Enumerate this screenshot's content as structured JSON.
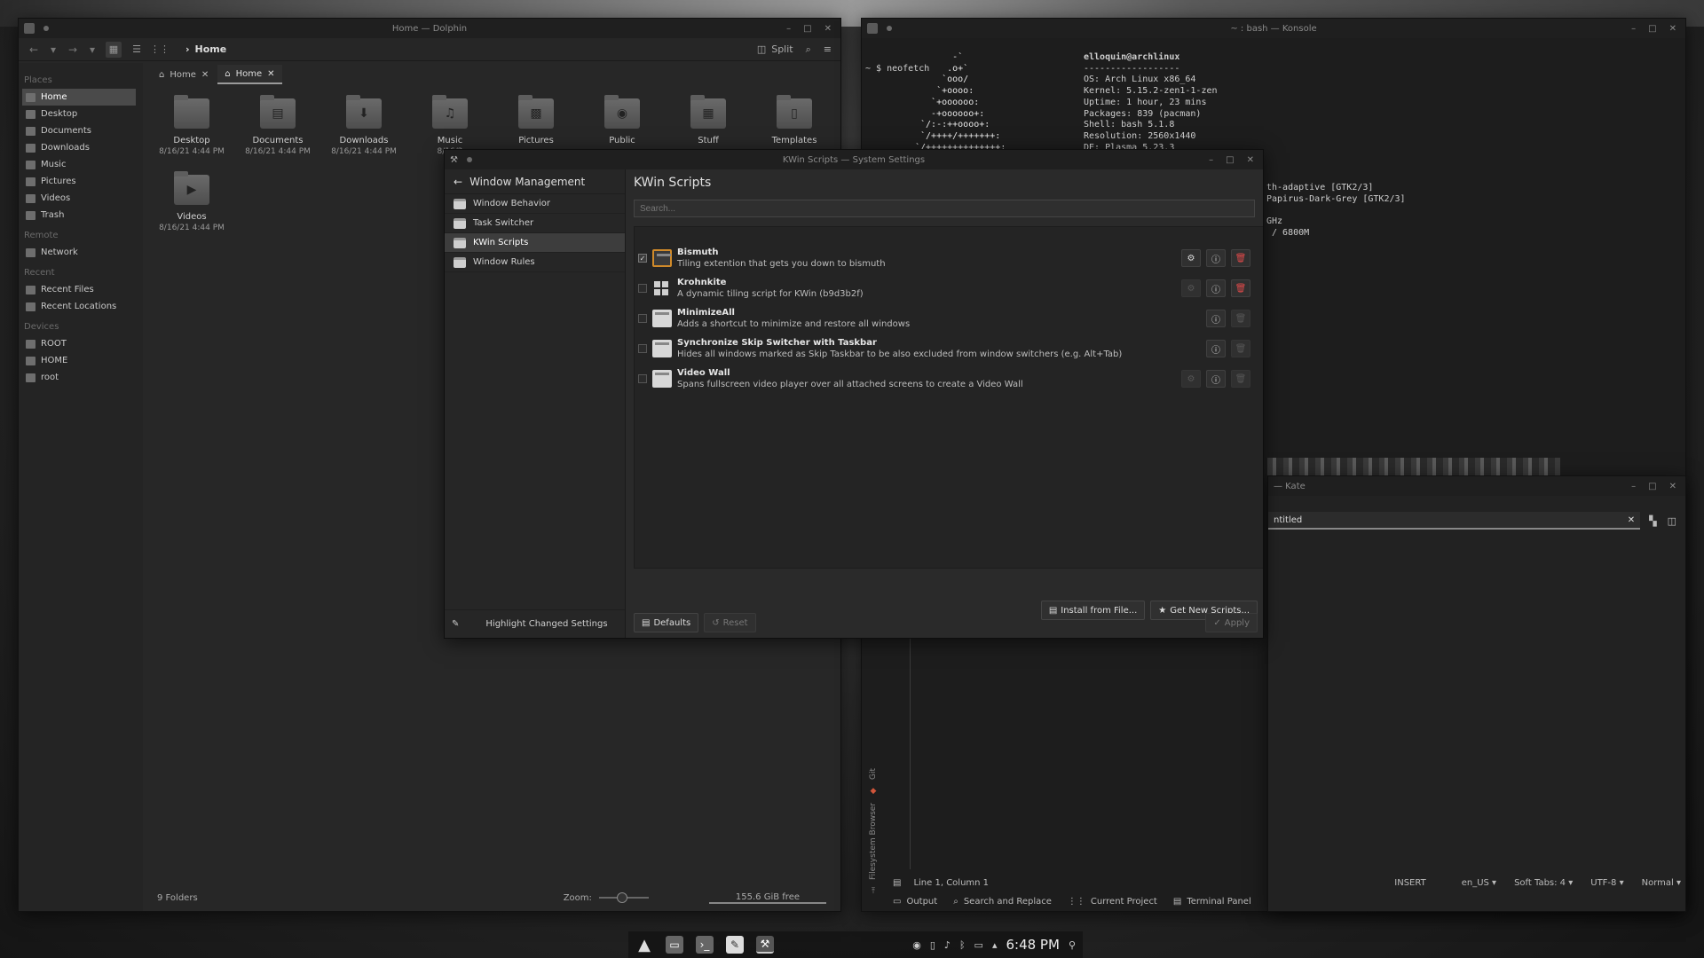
{
  "dolphin": {
    "title": "Home — Dolphin",
    "breadcrumb": "Home",
    "split_label": "Split",
    "tabs": [
      {
        "label": "Home"
      },
      {
        "label": "Home"
      }
    ],
    "places": {
      "sections": [
        {
          "label": "Places",
          "items": [
            "Home",
            "Desktop",
            "Documents",
            "Downloads",
            "Music",
            "Pictures",
            "Videos",
            "Trash"
          ]
        },
        {
          "label": "Remote",
          "items": [
            "Network"
          ]
        },
        {
          "label": "Recent",
          "items": [
            "Recent Files",
            "Recent Locations"
          ]
        },
        {
          "label": "Devices",
          "items": [
            "ROOT",
            "HOME",
            "root"
          ]
        }
      ]
    },
    "folders": [
      {
        "name": "Desktop",
        "date": "8/16/21 4:44 PM"
      },
      {
        "name": "Documents",
        "date": "8/16/21 4:44 PM"
      },
      {
        "name": "Downloads",
        "date": "8/16/21 4:44 PM"
      },
      {
        "name": "Music",
        "date": "8/16/2"
      },
      {
        "name": "Pictures",
        "date": ""
      },
      {
        "name": "Public",
        "date": ""
      },
      {
        "name": "Stuff",
        "date": ""
      },
      {
        "name": "Templates",
        "date": ""
      },
      {
        "name": "Videos",
        "date": "8/16/21 4:44 PM"
      }
    ],
    "status": {
      "count": "9 Folders",
      "zoom_label": "Zoom:",
      "free": "155.6 GiB free"
    }
  },
  "konsole": {
    "title": "~ : bash — Konsole",
    "prompt": "~ $ neofetch",
    "ascii": "       -`\n      .o+`\n     `ooo/\n    `+oooo:\n   `+oooooo:\n   -+oooooo+:\n `/:-:++oooo+:\n `/++++/+++++++:\n`/++++++++++++++:",
    "info_lines": [
      "elloquin@archlinux",
      "------------------",
      "OS: Arch Linux x86_64",
      "Kernel: 5.15.2-zen1-1-zen",
      "Uptime: 1 hour, 23 mins",
      "Packages: 839 (pacman)",
      "Shell: bash 5.1.8",
      "Resolution: 2560x1440",
      "DE: Plasma 5.23.3"
    ],
    "right_text": "th-adaptive [GTK2/3]\nPapirus-Dark-Grey [GTK2/3]\n\nGHz\n / 6800M"
  },
  "kate": {
    "title": "— Kate",
    "tab": "ntitled",
    "side_git": "Git",
    "side_fs": "Filesystem Browser",
    "status": {
      "position": "Line 1, Column 1",
      "mode": "INSERT",
      "lang": "en_US",
      "tabs": "Soft Tabs: 4",
      "encoding": "UTF-8",
      "input": "Normal"
    },
    "bottom": [
      "Output",
      "Search and Replace",
      "Current Project",
      "Terminal Panel"
    ]
  },
  "settings": {
    "title": "KWin Scripts — System Settings",
    "back_label": "Window Management",
    "categories": [
      "Window Behavior",
      "Task Switcher",
      "KWin Scripts",
      "Window Rules"
    ],
    "highlight_label": "Highlight Changed Settings",
    "page_title": "KWin Scripts",
    "search_placeholder": "Search...",
    "scripts": [
      {
        "name": "Bismuth",
        "desc": "Tiling extention that gets you down to bismuth"
      },
      {
        "name": "Krohnkite",
        "desc": "A dynamic tiling script for KWin (b9d3b2f)"
      },
      {
        "name": "MinimizeAll",
        "desc": "Adds a shortcut to minimize and restore all windows"
      },
      {
        "name": "Synchronize Skip Switcher with Taskbar",
        "desc": "Hides all windows marked as Skip Taskbar to be also excluded from window switchers (e.g. Alt+Tab)"
      },
      {
        "name": "Video Wall",
        "desc": "Spans fullscreen video player over all attached screens to create a Video Wall"
      }
    ],
    "install_label": "Install from File...",
    "get_new_label": "Get New Scripts...",
    "defaults_label": "Defaults",
    "reset_label": "Reset",
    "apply_label": "Apply"
  },
  "taskbar": {
    "clock": "6:48 PM"
  }
}
